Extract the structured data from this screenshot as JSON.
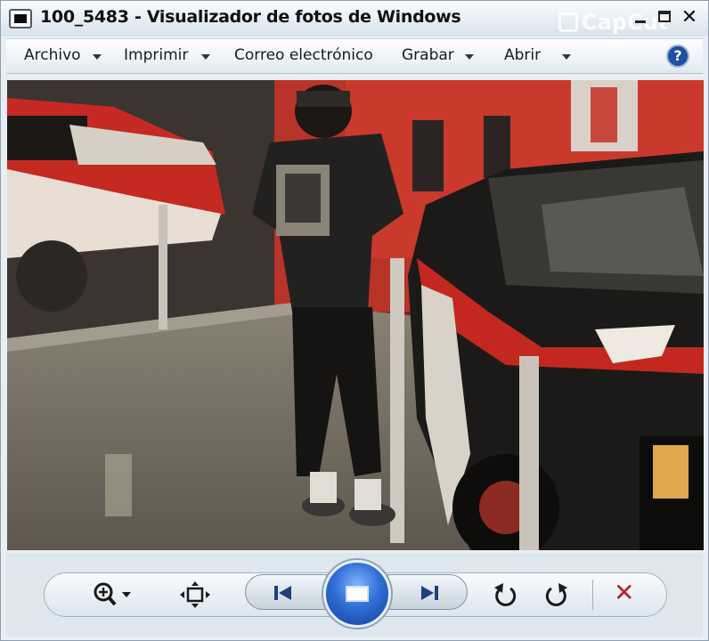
{
  "window": {
    "title": "100_5483 - Visualizador de fotos de Windows",
    "watermark": "CapCut",
    "close_glyph": "✕"
  },
  "menu": {
    "items": [
      "Archivo",
      "Imprimir",
      "Correo electrónico",
      "Grabar",
      "Abrir"
    ],
    "help_glyph": "?"
  },
  "photo": {
    "description_icon": "photo-image"
  },
  "toolbar": {
    "zoom_icon": "zoom-icon",
    "delete_glyph": "✕"
  },
  "colors": {
    "accent": "#1f4fa3",
    "delete_red": "#b3261e"
  }
}
